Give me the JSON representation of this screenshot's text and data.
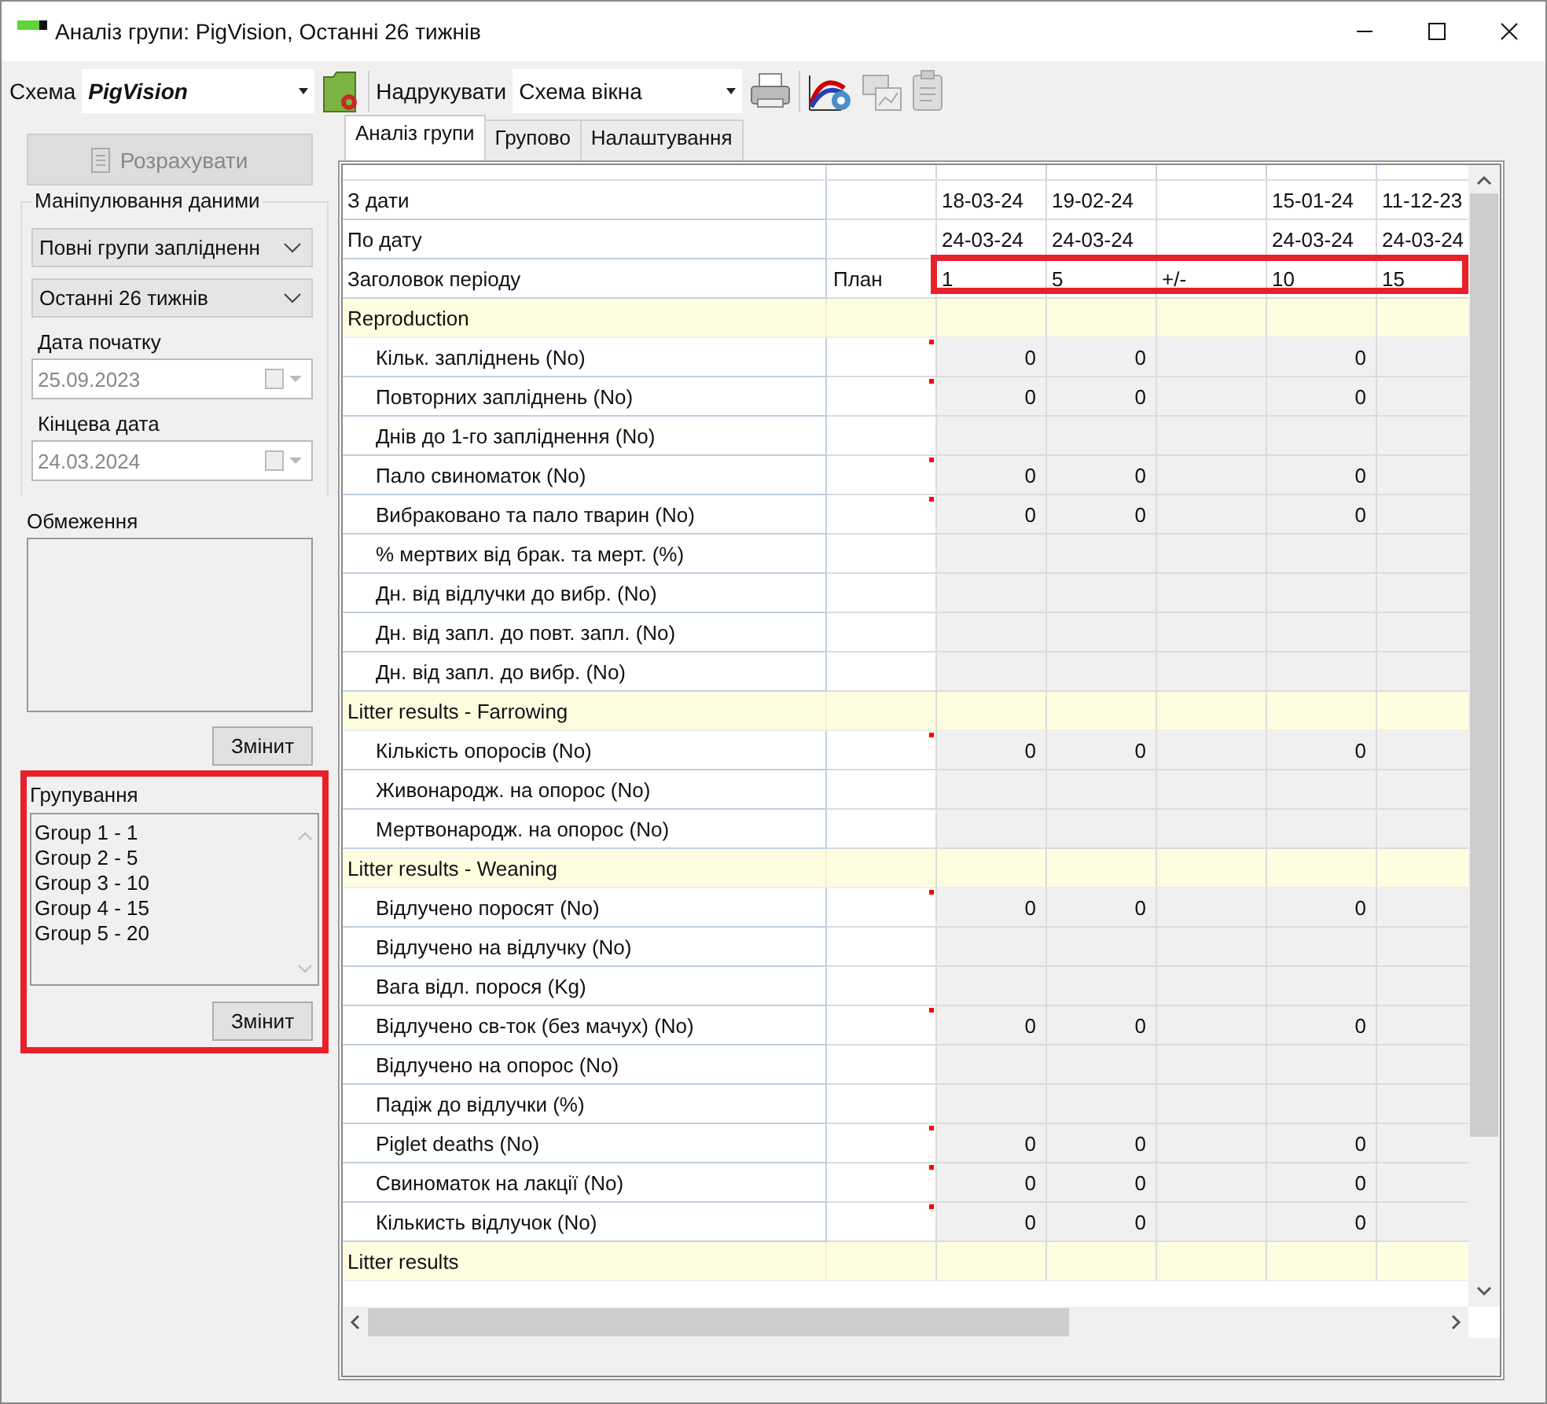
{
  "window": {
    "title": "Аналіз групи: PigVision, Останні 26 тижнів"
  },
  "toolbar": {
    "scheme_label": "Схема",
    "scheme_value": "PigVision",
    "print_label": "Надрукувати",
    "print_value": "Схема вікна"
  },
  "sidebar": {
    "calculate_button": {
      "label": "Розрахувати",
      "disabled": true
    },
    "data_group": {
      "title": "Маніпулювання даними",
      "selects": [
        "Повні групи заплідненн",
        "Останні 26 тижнів"
      ],
      "start_label": "Дата початку",
      "start_value": "25.09.2023",
      "end_label": "Кінцева дата",
      "end_value": "24.03.2024",
      "dates_disabled": true
    },
    "restrictions": {
      "label": "Обмеження",
      "button": "Змінит"
    },
    "grouping": {
      "label": "Групування",
      "highlighted": true,
      "items": [
        "Group 1 - 1",
        "Group 2 - 5",
        "Group 3 - 10",
        "Group 4 - 15",
        "Group 5 - 20"
      ],
      "button": "Змінит"
    }
  },
  "tabs": [
    {
      "label": "Аналіз групи",
      "selected": true
    },
    {
      "label": "Групово",
      "selected": false
    },
    {
      "label": "Налаштування",
      "selected": false
    }
  ],
  "grid": {
    "header_highlighted": true,
    "rows": [
      {
        "kind": "date",
        "label": "З дати",
        "values": {
          "period_1": "18-03-24",
          "period_2": "19-02-24",
          "period_4": "15-01-24",
          "period_5": "11-12-23"
        }
      },
      {
        "kind": "date",
        "label": "По дату",
        "values": {
          "period_1": "24-03-24",
          "period_2": "24-03-24",
          "period_4": "24-03-24",
          "period_5": "24-03-24"
        }
      },
      {
        "kind": "header",
        "label": "Заголовок періоду",
        "plan": "План",
        "values": {
          "period_1": "1",
          "period_2": "5",
          "period_3": "+/-",
          "period_4": "10",
          "period_5": "15"
        }
      },
      {
        "kind": "group",
        "label": "Reproduction"
      },
      {
        "kind": "item",
        "label": "Кільк. запліднень (No)",
        "flagged": true,
        "values": {
          "period_1": "0",
          "period_2": "0",
          "period_4": "0"
        }
      },
      {
        "kind": "item",
        "label": "Повторних запліднень (No)",
        "flagged": true,
        "values": {
          "period_1": "0",
          "period_2": "0",
          "period_4": "0"
        }
      },
      {
        "kind": "item",
        "label": "Днів до 1-го запліднення (No)"
      },
      {
        "kind": "item",
        "label": "Пало свиноматок (No)",
        "flagged": true,
        "values": {
          "period_1": "0",
          "period_2": "0",
          "period_4": "0"
        }
      },
      {
        "kind": "item",
        "label": "Вибраковано та пало тварин (No)",
        "flagged": true,
        "values": {
          "period_1": "0",
          "period_2": "0",
          "period_4": "0"
        }
      },
      {
        "kind": "item",
        "label": "% мертвих від брак. та мерт. (%)"
      },
      {
        "kind": "item",
        "label": "Дн. від відлучки до вибр. (No)"
      },
      {
        "kind": "item",
        "label": "Дн. від запл. до повт. запл. (No)"
      },
      {
        "kind": "item",
        "label": "Дн. від запл. до вибр. (No)"
      },
      {
        "kind": "group",
        "label": "Litter results - Farrowing"
      },
      {
        "kind": "item",
        "label": "Кількість опоросів (No)",
        "flagged": true,
        "values": {
          "period_1": "0",
          "period_2": "0",
          "period_4": "0"
        }
      },
      {
        "kind": "item",
        "label": "Живонародж. на опорос (No)"
      },
      {
        "kind": "item",
        "label": "Мертвонародж. на опорос (No)"
      },
      {
        "kind": "group",
        "label": "Litter results - Weaning"
      },
      {
        "kind": "item",
        "label": "Відлучено поросят (No)",
        "flagged": true,
        "values": {
          "period_1": "0",
          "period_2": "0",
          "period_4": "0"
        }
      },
      {
        "kind": "item",
        "label": "Відлучено на відлучку (No)"
      },
      {
        "kind": "item",
        "label": "Вага відл. порося (Kg)"
      },
      {
        "kind": "item",
        "label": "Відлучено св-ток (без мачух) (No)",
        "flagged": true,
        "values": {
          "period_1": "0",
          "period_2": "0",
          "period_4": "0"
        }
      },
      {
        "kind": "item",
        "label": "Відлучено на опорос (No)"
      },
      {
        "kind": "item",
        "label": "Падіж до відлучки (%)"
      },
      {
        "kind": "item",
        "label": "Piglet deaths (No)",
        "flagged": true,
        "values": {
          "period_1": "0",
          "period_2": "0",
          "period_4": "0"
        }
      },
      {
        "kind": "item",
        "label": "Свиноматок на лакції (No)",
        "flagged": true,
        "values": {
          "period_1": "0",
          "period_2": "0",
          "period_4": "0"
        }
      },
      {
        "kind": "item",
        "label": "Кількисть відлучок (No)",
        "flagged": true,
        "values": {
          "period_1": "0",
          "period_2": "0",
          "period_4": "0"
        }
      },
      {
        "kind": "group",
        "label": "Litter results"
      }
    ]
  }
}
